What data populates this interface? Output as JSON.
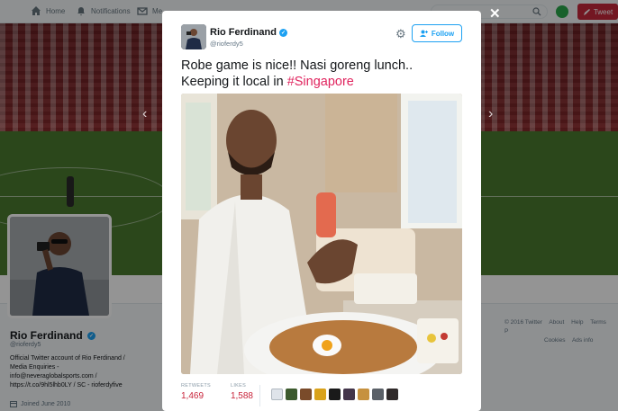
{
  "topbar": {
    "home": "Home",
    "notifications": "Notifications",
    "messages": "Me",
    "tweet": "Tweet"
  },
  "profile": {
    "name": "Rio Ferdinand",
    "handle": "@rioferdy5",
    "bio_lines": [
      "Official Twitter account of Rio Ferdinand /",
      "Media Enquiries -",
      "info@neveraglobalsports.com /",
      "https://t.co/9hl5lhb0LY / SC - rioferdyfive"
    ],
    "joined": "Joined June 2010"
  },
  "footer": {
    "items": [
      "© 2016 Twitter",
      "About",
      "Help",
      "Terms",
      "P",
      "Cookies",
      "Ads info"
    ]
  },
  "tweet": {
    "author_name": "Rio Ferdinand",
    "author_handle": "@rioferdy5",
    "follow_label": "Follow",
    "text_line1": "Robe game is nice!! Nasi goreng lunch..",
    "text_line2_prefix": "Keeping it local in ",
    "hashtag": "#Singapore",
    "retweets_label": "RETWEETS",
    "retweets": "1,469",
    "likes_label": "LIKES",
    "likes": "1,588"
  },
  "colors": {
    "accent": "#1da1f2",
    "hashtag": "#e0245e",
    "stat": "#c8233a",
    "tweet_button": "#c6283b"
  }
}
